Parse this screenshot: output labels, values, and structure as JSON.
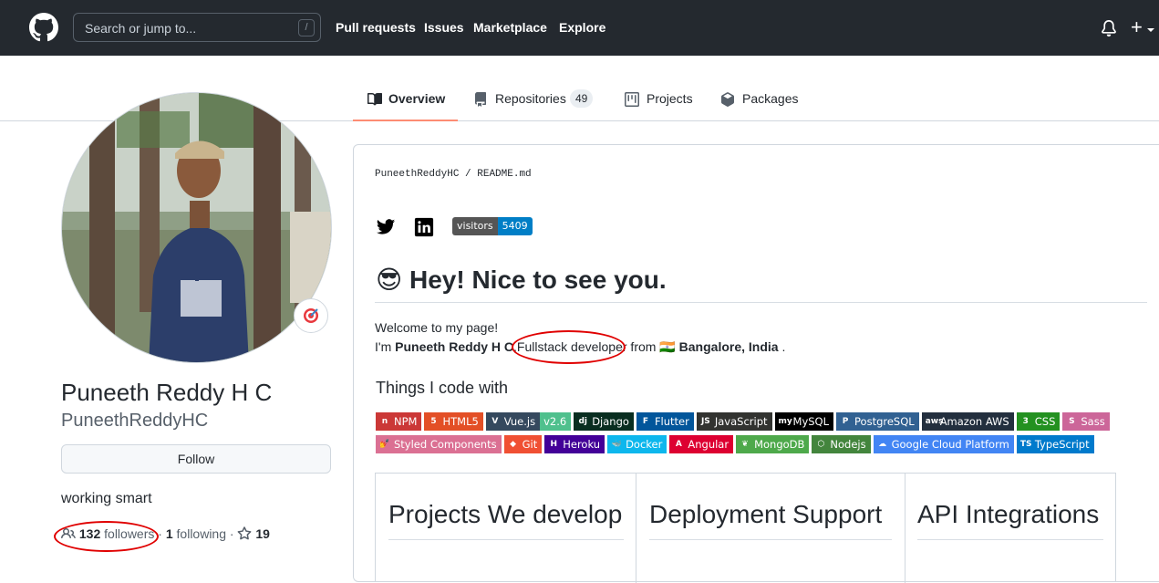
{
  "header": {
    "search_placeholder": "Search or jump to...",
    "search_shortcut": "/",
    "nav": [
      "Pull requests",
      "Issues",
      "Marketplace",
      "Explore"
    ],
    "plus": "+"
  },
  "tabs": [
    {
      "label": "Overview",
      "icon": "book-icon",
      "active": true
    },
    {
      "label": "Repositories",
      "icon": "repo-icon",
      "count": "49"
    },
    {
      "label": "Projects",
      "icon": "project-icon"
    },
    {
      "label": "Packages",
      "icon": "package-icon"
    }
  ],
  "profile": {
    "name": "Puneeth Reddy H C",
    "login": "PuneethReddyHC",
    "follow_label": "Follow",
    "bio": "working smart",
    "followers_count": "132",
    "followers_label": "followers",
    "separator": "·",
    "following_count": "1",
    "following_label": "following",
    "stars_count": "19",
    "status_emoji": "🎯"
  },
  "readme": {
    "owner": "PuneethReddyHC",
    "sep": "/",
    "file": "README.md",
    "visitors_label": "visitors",
    "visitors_count": "5409",
    "heading_emoji": "😎",
    "heading": "Hey! Nice to see you.",
    "welcome": "Welcome to my page!",
    "intro_prefix": "I'm ",
    "intro_name": "Puneeth Reddy H C",
    "intro_comma": ",",
    "intro_role": "Fullstack developer",
    "intro_from": " from ",
    "intro_flag": "🇮🇳",
    "intro_place": "Bangalore, India",
    "intro_end": " .",
    "things_heading": "Things I code with",
    "badges_row1": [
      {
        "label": "NPM",
        "glyph": "n",
        "color": "#cb3837"
      },
      {
        "label": "HTML5",
        "glyph": "5",
        "color": "#e34f26"
      },
      {
        "label": "Vue.js",
        "glyph": "V",
        "color": "#35495e",
        "extra": "v2.6",
        "extra_color": "#4fc08d"
      },
      {
        "label": "Django",
        "glyph": "dj",
        "color": "#092e20"
      },
      {
        "label": "Flutter",
        "glyph": "F",
        "color": "#02569b"
      },
      {
        "label": "JavaScript",
        "glyph": "JS",
        "color": "#323330"
      },
      {
        "label": "MySQL",
        "glyph": "my",
        "color": "#000000"
      },
      {
        "label": "PostgreSQL",
        "glyph": "P",
        "color": "#316192"
      },
      {
        "label": "Amazon AWS",
        "glyph": "aws",
        "color": "#232f3e"
      },
      {
        "label": "CSS",
        "glyph": "3",
        "color": "#239120"
      },
      {
        "label": "Sass",
        "glyph": "S",
        "color": "#cc6699"
      }
    ],
    "badges_row2": [
      {
        "label": "Styled Components",
        "glyph": "💅",
        "color": "#db7093"
      },
      {
        "label": "Git",
        "glyph": "◆",
        "color": "#f05033"
      },
      {
        "label": "Heroku",
        "glyph": "H",
        "color": "#430098"
      },
      {
        "label": "Docker",
        "glyph": "🐳",
        "color": "#0db7ed"
      },
      {
        "label": "Angular",
        "glyph": "A",
        "color": "#dd0031"
      },
      {
        "label": "MongoDB",
        "glyph": "❦",
        "color": "#4ea94b"
      },
      {
        "label": "Nodejs",
        "glyph": "⬡",
        "color": "#43853d"
      },
      {
        "label": "Google Cloud Platform",
        "glyph": "☁",
        "color": "#4285f4"
      },
      {
        "label": "TypeScript",
        "glyph": "TS",
        "color": "#007acc"
      }
    ],
    "table_headers": [
      "Projects We develop",
      "Deployment Support",
      "API Integrations"
    ]
  },
  "colors": {
    "header_bg": "#24292f",
    "active_tab_underline": "#fd8c73",
    "annotation_red": "#e00000",
    "visitors_left": "#555555",
    "visitors_right": "#007ec6"
  }
}
